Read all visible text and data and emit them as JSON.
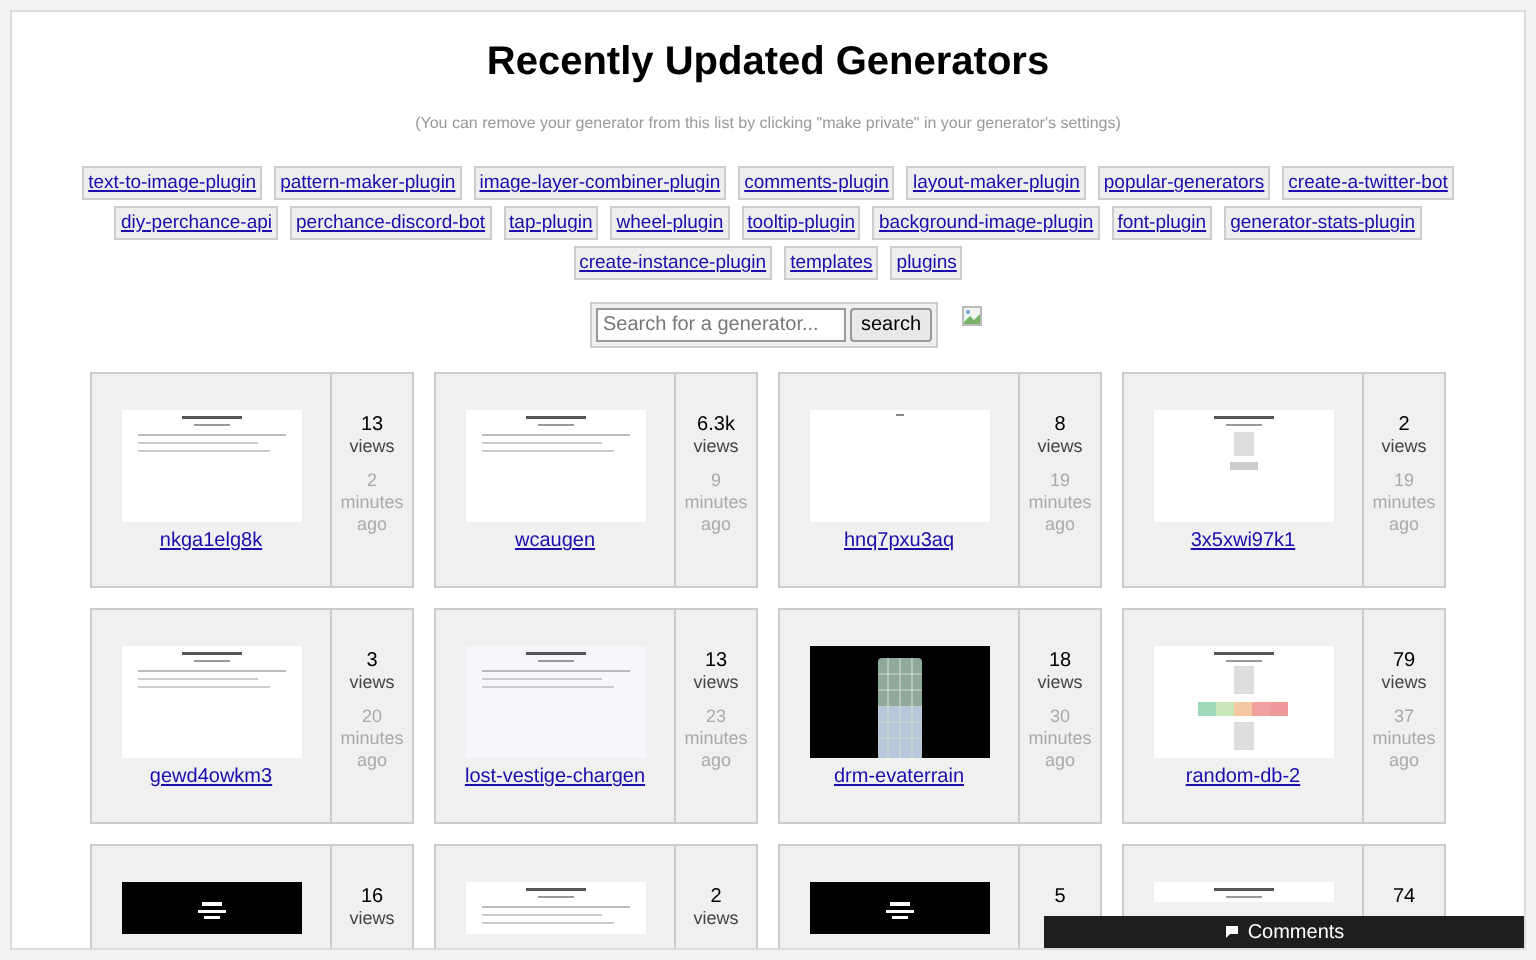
{
  "title": "Recently Updated Generators",
  "note": "(You can remove your generator from this list by clicking \"make private\" in your generator's settings)",
  "tags": [
    [
      "text-to-image-plugin",
      "pattern-maker-plugin",
      "image-layer-combiner-plugin",
      "comments-plugin",
      "layout-maker-plugin",
      "popular-generators",
      "create-a-twitter-bot"
    ],
    [
      "diy-perchance-api",
      "perchance-discord-bot",
      "tap-plugin",
      "wheel-plugin",
      "tooltip-plugin",
      "background-image-plugin",
      "font-plugin",
      "generator-stats-plugin"
    ],
    [
      "create-instance-plugin",
      "templates",
      "plugins"
    ]
  ],
  "search": {
    "placeholder": "Search for a generator...",
    "button": "search"
  },
  "cards": [
    {
      "kind": "picture",
      "name": "nkga1elg8k",
      "views": "13",
      "views_label": "views",
      "time": [
        "2",
        "minutes",
        "ago"
      ]
    },
    {
      "kind": "picture",
      "name": "wcaugen",
      "views": "6.3k",
      "views_label": "views",
      "time": [
        "9",
        "minutes",
        "ago"
      ]
    },
    {
      "kind": "picture",
      "name": "hnq7pxu3aq",
      "views": "8",
      "views_label": "views",
      "time": [
        "19",
        "minutes",
        "ago"
      ]
    },
    {
      "kind": "picture",
      "name": "3x5xwi97k1",
      "views": "2",
      "views_label": "views",
      "time": [
        "19",
        "minutes",
        "ago"
      ]
    },
    {
      "kind": "picture",
      "name": "gewd4owkm3",
      "views": "3",
      "views_label": "views",
      "time": [
        "20",
        "minutes",
        "ago"
      ]
    },
    {
      "kind": "picture",
      "name": "lost-vestige-chargen",
      "views": "13",
      "views_label": "views",
      "time": [
        "23",
        "minutes",
        "ago"
      ]
    },
    {
      "kind": "picture",
      "name": "drm-evaterrain",
      "views": "18",
      "views_label": "views",
      "time": [
        "30",
        "minutes",
        "ago"
      ]
    },
    {
      "kind": "picture",
      "name": "random-db-2",
      "views": "79",
      "views_label": "views",
      "time": [
        "37",
        "minutes",
        "ago"
      ]
    },
    {
      "kind": "picture",
      "views": "16",
      "views_label": "views"
    },
    {
      "kind": "picture",
      "views": "2",
      "views_label": "views"
    },
    {
      "kind": "picture",
      "views": "5"
    },
    {
      "kind": "picture",
      "views": "74"
    }
  ],
  "comments_bar": {
    "label": "Comments"
  }
}
